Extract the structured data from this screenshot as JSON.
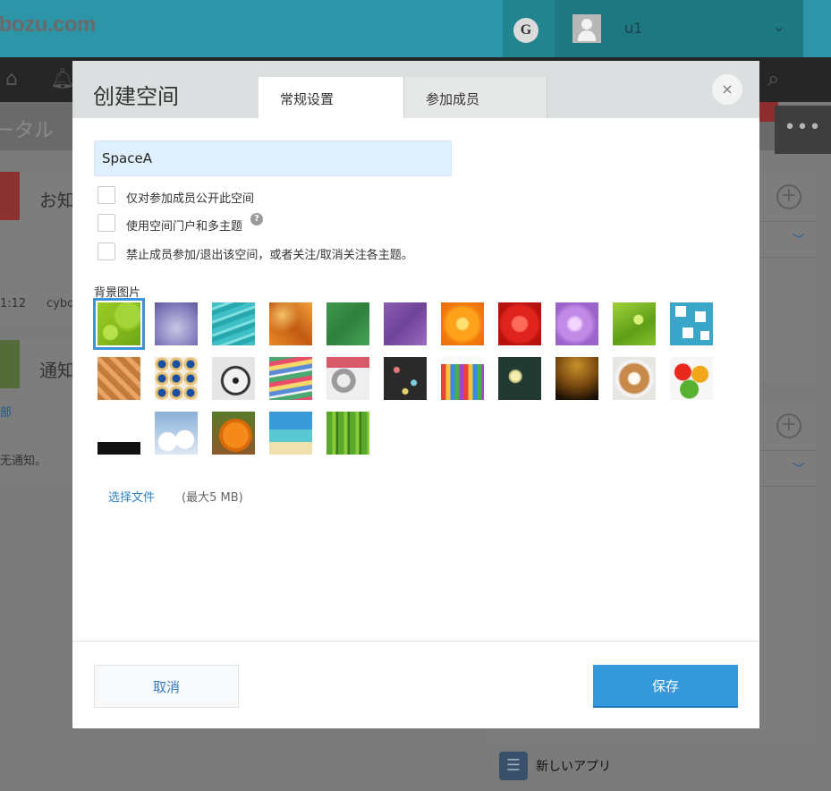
{
  "app": {
    "logo_text": "ybozu.com",
    "header": {
      "g_badge": "G",
      "user_name": "u1"
    },
    "portal_title": "ータル",
    "cards": {
      "notice_title": "お知",
      "notice_time": "1:12",
      "notice_source": "cybo",
      "notify_title": "通知",
      "notify_link": "部",
      "notify_empty": "无通知。"
    },
    "bottom_app_label": "新しいアプリ"
  },
  "dialog": {
    "title": "创建空间",
    "tabs": [
      {
        "label": "常规设置",
        "active": true
      },
      {
        "label": "参加成员",
        "active": false
      }
    ],
    "space_name_value": "SpaceA",
    "checkboxes": [
      {
        "label": "仅对参加成员公开此空间",
        "checked": false
      },
      {
        "label": "使用空间门户和多主题",
        "checked": false,
        "has_help_icon": true
      },
      {
        "label": "禁止成员参加/退出该空间，或者关注/取消关注各主题。",
        "checked": false
      }
    ],
    "background_label": "背景图片",
    "selected_background": "green-swirl",
    "backgrounds": [
      "green-swirl",
      "lavender-gradient",
      "teal-water",
      "orange-texture",
      "green-felt",
      "purple-fabric",
      "orange-flower",
      "red-flower",
      "purple-flower",
      "green-leaf",
      "blue-blocks",
      "wood-weave",
      "mosaic-tiles",
      "compass",
      "stacked-books",
      "gears",
      "chalkboard-doodles",
      "colored-pencils",
      "lightbulb-chalk",
      "dark-gradient",
      "latte-art",
      "vegetables",
      "cat-peeking",
      "snowy-trees",
      "pumpkins",
      "palm-beach",
      "bamboo"
    ],
    "choose_file_label": "选择文件",
    "max_size_text": "(最大5 MB)",
    "cancel_label": "取消",
    "save_label": "保存",
    "close_symbol": "×"
  }
}
